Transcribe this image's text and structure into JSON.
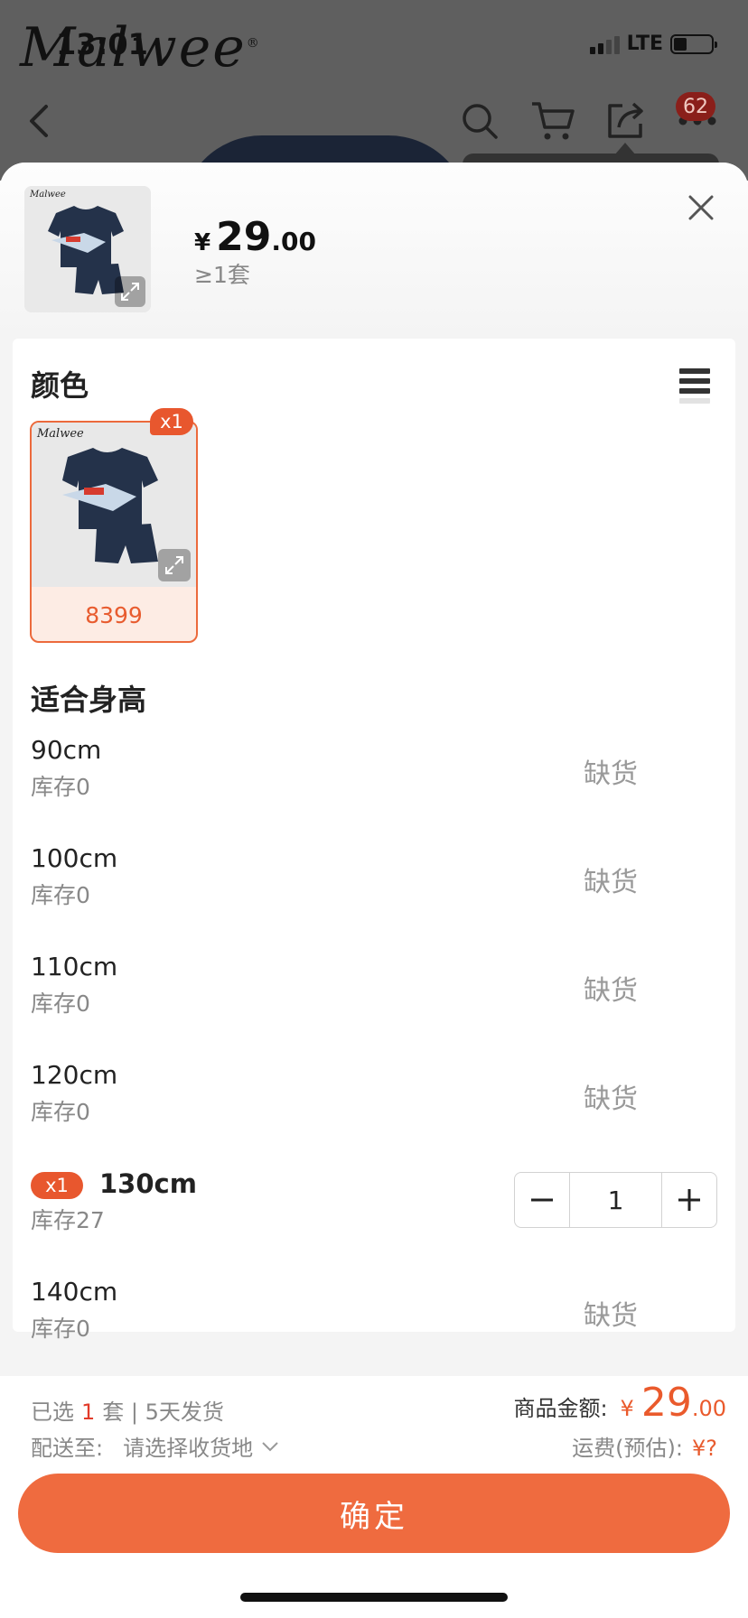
{
  "status": {
    "time": "13:01",
    "network": "LTE"
  },
  "background": {
    "brand_logo": "Malwee",
    "cart_badge": "62"
  },
  "header": {
    "currency": "¥",
    "price_int": "29",
    "price_dec": ".00",
    "moq": "≥1套"
  },
  "color_section": {
    "title": "颜色",
    "option": {
      "code": "8399",
      "qty_badge": "x1"
    }
  },
  "size_section": {
    "title": "适合身高",
    "sizes": [
      {
        "name": "90cm",
        "stock": "库存0",
        "status": "缺货"
      },
      {
        "name": "100cm",
        "stock": "库存0",
        "status": "缺货"
      },
      {
        "name": "110cm",
        "stock": "库存0",
        "status": "缺货"
      },
      {
        "name": "120cm",
        "stock": "库存0",
        "status": "缺货"
      },
      {
        "name": "130cm",
        "stock": "库存27",
        "badge": "x1",
        "quantity": "1"
      },
      {
        "name": "140cm",
        "stock": "库存0",
        "status": "缺货"
      }
    ]
  },
  "footer": {
    "selected_prefix": "已选",
    "selected_count": "1",
    "selected_suffix": "套 | 5天发货",
    "ship_to_label": "配送至:",
    "ship_to_value": "请选择收货地",
    "amount_label": "商品金额:",
    "amount_currency": "¥",
    "amount_int": "29",
    "amount_dec": ".00",
    "shipping_label": "运费(预估):",
    "shipping_value": "¥?",
    "confirm_label": "确定"
  },
  "colors": {
    "accent": "#ef6b3f",
    "price_red": "#ea5a2c",
    "badge": "#e8572e",
    "sheet_bg": "#f4f4f4"
  }
}
